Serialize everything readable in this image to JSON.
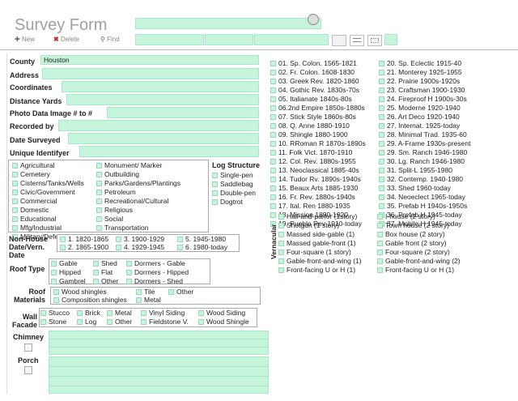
{
  "app": {
    "title": "Survey Form"
  },
  "toolbar": {
    "new_label": "New",
    "delete_label": "Delete",
    "find_label": "Find"
  },
  "fields": {
    "county_label": "County",
    "county_value": "Houston",
    "address_label": "Address",
    "coordinates_label": "Coordinates",
    "distance_label": "Distance Yards",
    "photo_label": "Photo Data Image # to #",
    "recorded_label": "Recorded by",
    "date_label": "Date Surveyed",
    "uid_label": "Unique Identifyer"
  },
  "site_types": {
    "col1": [
      "Agricultural",
      "Cemetery",
      "Cisterns/Tanks/Wells",
      "Civic/Government",
      "Commercial",
      "Domestic",
      "Educational",
      "Mfg/Industrial",
      "Military/Defense"
    ],
    "col2": [
      "Monument/ Marker",
      "Outbuilding",
      "Parks/Gardens/Plantings",
      "Petroleum",
      "Recreational/Cultural",
      "Religious",
      "Social",
      "Transportation"
    ]
  },
  "log_structure": {
    "title": "Log Structure",
    "items": [
      "Single-pen",
      "Saddlebag",
      "Double-pen",
      "Dogtrot"
    ]
  },
  "nonhouse": {
    "label": "Non-House Date/Vern. Date",
    "items": [
      "1. 1820-1865",
      "2. 1865-1900",
      "3. 1900-1929",
      "4. 1929-1945",
      "5. 1945-1980",
      "6. 1980-today"
    ]
  },
  "roof_type": {
    "label": "Roof Type",
    "items": [
      "Gable",
      "Hipped",
      "Gambrel",
      "Shed",
      "Flat",
      "Other",
      "Dormers - Gable",
      "Dormers - Hipped",
      "Dormers - Shed"
    ]
  },
  "roof_materials": {
    "label": "Roof Materials",
    "items": [
      "Wood shingles",
      "Composition shingles",
      "Tile",
      "Metal",
      "Other"
    ]
  },
  "wall_facade": {
    "label": "Wall Facade",
    "items": [
      "Stucco",
      "Stone",
      "Brick",
      "Log",
      "Metal",
      "Other",
      "Vinyl Siding",
      "Fieldstone V.",
      "Wood Siding",
      "Wood Shingle"
    ]
  },
  "chimney_label": "Chimney",
  "porch_label": "Porch",
  "styles_col1": [
    "01. Sp. Colon. 1565-1821",
    "02. Fr. Colon. 1608-1830",
    "03. Greek Rev. 1820-1860",
    "04. Gothic Rev. 1830s-70s",
    "05. Italianate 1840s-80s",
    "06.2nd Empire 1850s-1880s",
    "07. Stick Style 1860s-80s",
    "08. Q. Anne 1880-1910",
    "09. Shingle 1880-1900",
    "10. RRoman R 1870s-1890s",
    "11. Folk Vict. 1870-1910",
    "12. Col. Rev. 1880s-1955",
    "13. Neoclassical 1885-40s",
    "14. Tudor Rv. 1890s-1940s",
    "15. Beaux Arts 1885-1930",
    "16. Fr. Rev. 1880s-1940s",
    "17. Ital. Ren 1880-1935",
    "18. Mission 1890-1920",
    "19. Pueblo Rev 1910-today"
  ],
  "styles_col2": [
    "20. Sp. Eclectic 1915-40",
    "21. Monterey 1925-1955",
    "22. Prairie 1900s-1920s",
    "23. Craftsman 1900-1930",
    "24. Fireproof H 1900s-30s",
    "25. Moderne 1920-1940",
    "26. Art Deco 1920-1940",
    "27. Internat. 1925-today",
    "28. Minimal Trad. 1935-60",
    "29. A-Frame 1930s-present",
    "29. Sm. Ranch  1946-1980",
    "30. Lg. Ranch 1946-1980",
    "31. Split-L 1955-1980",
    "32. Contemp. 1940-1980",
    "33. Shed 1960-today",
    "34. Neoeclect 1965-today",
    "35. Prefab H 1940s-1950s",
    "36. Prefab H 1945-today",
    "37. Mobile H 1945-today"
  ],
  "vernacular": {
    "label": "Vernacular",
    "col1": [
      "Hall-and-parlor (1story)",
      "Shotgun (1 story)",
      "Massed side-gable (1)",
      "Massed gable-front (1)",
      "Four-square (1 story)",
      "Gable-front-and-wing (1)",
      "Front-facing U or H (1)"
    ],
    "col2": [
      "I-house (2 story)",
      "Town house (2 story)",
      "Box house (2 story)",
      "Gable front (2 story)",
      "Four-square (2 story)",
      "Gable-front-and-wing (2)",
      "Front-facing U or H (1)"
    ]
  }
}
